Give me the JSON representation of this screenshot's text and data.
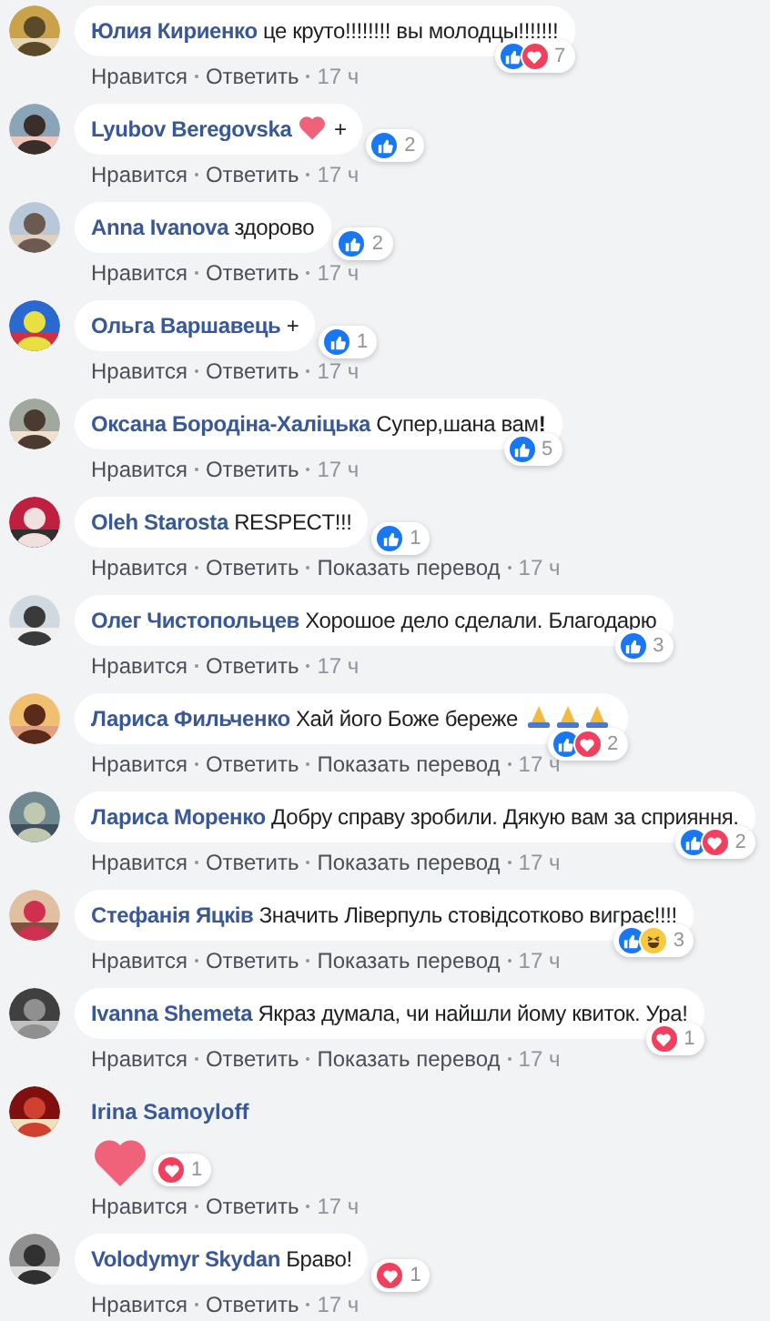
{
  "comments": [
    {
      "author": "Юлия Кириенко",
      "text": "це круто!!!!!!!! вы молодцы!!!!!!!",
      "reactions": [
        {
          "kind": "like"
        },
        {
          "kind": "love"
        }
      ],
      "count": "7",
      "actions": [
        "Нравится",
        "Ответить"
      ],
      "time": "17 ч"
    },
    {
      "author": "Lyubov Beregovska",
      "emoji": [
        {
          "kind": "heart"
        }
      ],
      "text_after": "+",
      "reactions": [
        {
          "kind": "like"
        }
      ],
      "count": "2",
      "actions": [
        "Нравится",
        "Ответить"
      ],
      "time": "17 ч"
    },
    {
      "author": "Anna Ivanova",
      "text": "здорово",
      "reactions": [
        {
          "kind": "like"
        }
      ],
      "count": "2",
      "actions": [
        "Нравится",
        "Ответить"
      ],
      "time": "17 ч"
    },
    {
      "author": "Ольга Варшавець",
      "text": "+",
      "reactions": [
        {
          "kind": "like"
        }
      ],
      "count": "1",
      "actions": [
        "Нравится",
        "Ответить"
      ],
      "time": "17 ч"
    },
    {
      "author": "Оксана Бородіна-Халіцька",
      "text": "Супер,шана вам**!**",
      "reactions": [
        {
          "kind": "like"
        }
      ],
      "count": "5",
      "actions": [
        "Нравится",
        "Ответить"
      ],
      "time": "17 ч"
    },
    {
      "author": "Oleh Starosta",
      "text": "RESPECT!!!",
      "reactions": [
        {
          "kind": "like"
        }
      ],
      "count": "1",
      "actions": [
        "Нравится",
        "Ответить",
        "Показать перевод"
      ],
      "time": "17 ч"
    },
    {
      "author": "Олег Чистопольцев",
      "text": "Хорошое дело сделали. Благодарю",
      "reactions": [
        {
          "kind": "like"
        }
      ],
      "count": "3",
      "actions": [
        "Нравится",
        "Ответить"
      ],
      "time": "17 ч"
    },
    {
      "author": "Лариса Фильченко",
      "text": "Хай його Боже береже",
      "emoji": [
        {
          "kind": "pray"
        },
        {
          "kind": "pray"
        },
        {
          "kind": "pray"
        }
      ],
      "reactions": [
        {
          "kind": "like"
        },
        {
          "kind": "love"
        }
      ],
      "count": "2",
      "actions": [
        "Нравится",
        "Ответить",
        "Показать перевод"
      ],
      "time": "17 ч"
    },
    {
      "author": "Лариса Моренко",
      "text": "Добру справу зробили. Дякую вам за сприяння.",
      "reactions": [
        {
          "kind": "like"
        },
        {
          "kind": "love"
        }
      ],
      "count": "2",
      "actions": [
        "Нравится",
        "Ответить",
        "Показать перевод"
      ],
      "time": "17 ч"
    },
    {
      "author": "Стефанія Яцків",
      "text": "Значить Ліверпуль стовідсотково виграє!!!!",
      "reactions": [
        {
          "kind": "like"
        },
        {
          "kind": "haha"
        }
      ],
      "count": "3",
      "actions": [
        "Нравится",
        "Ответить",
        "Показать перевод"
      ],
      "time": "17 ч"
    },
    {
      "author": "Ivanna Shemeta",
      "text": "Якраз думала, чи найшли йому квиток. Ура!",
      "reactions": [
        {
          "kind": "love"
        }
      ],
      "count": "1",
      "actions": [
        "Нравится",
        "Ответить",
        "Показать перевод"
      ],
      "time": "17 ч"
    },
    {
      "author": "Irina Samoyloff",
      "big_emoji": [
        {
          "kind": "heart"
        }
      ],
      "reactions": [
        {
          "kind": "love"
        }
      ],
      "count": "1",
      "actions": [
        "Нравится",
        "Ответить"
      ],
      "time": "17 ч"
    },
    {
      "author": "Volodymyr Skydan",
      "text": "Браво!",
      "reactions": [
        {
          "kind": "love"
        }
      ],
      "count": "1",
      "actions": [
        "Нравится",
        "Ответить"
      ],
      "time": "17 ч"
    }
  ]
}
